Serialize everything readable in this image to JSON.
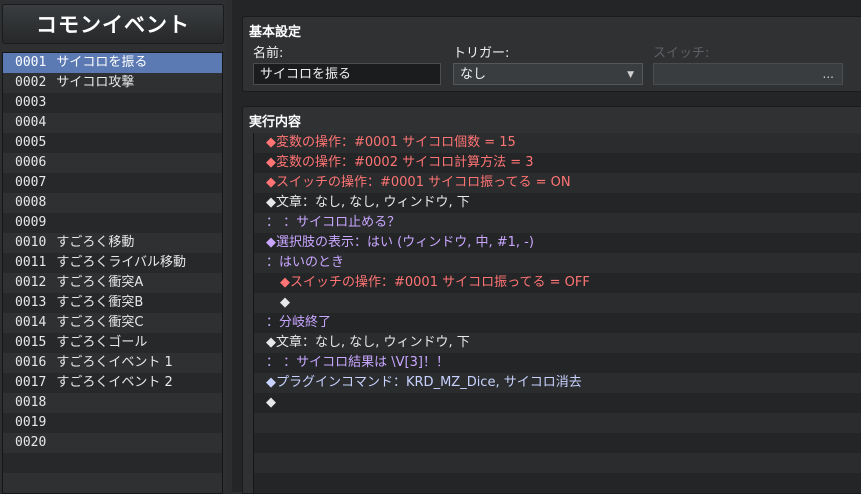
{
  "left_panel": {
    "title": "コモンイベント",
    "events": [
      {
        "id": "0001",
        "name": "サイコロを振る"
      },
      {
        "id": "0002",
        "name": "サイコロ攻撃"
      },
      {
        "id": "0003",
        "name": ""
      },
      {
        "id": "0004",
        "name": ""
      },
      {
        "id": "0005",
        "name": ""
      },
      {
        "id": "0006",
        "name": ""
      },
      {
        "id": "0007",
        "name": ""
      },
      {
        "id": "0008",
        "name": ""
      },
      {
        "id": "0009",
        "name": ""
      },
      {
        "id": "0010",
        "name": "すごろく移動"
      },
      {
        "id": "0011",
        "name": "すごろくライバル移動"
      },
      {
        "id": "0012",
        "name": "すごろく衝突A"
      },
      {
        "id": "0013",
        "name": "すごろく衝突B"
      },
      {
        "id": "0014",
        "name": "すごろく衝突C"
      },
      {
        "id": "0015",
        "name": "すごろくゴール"
      },
      {
        "id": "0016",
        "name": "すごろくイベント 1"
      },
      {
        "id": "0017",
        "name": "すごろくイベント 2"
      },
      {
        "id": "0018",
        "name": ""
      },
      {
        "id": "0019",
        "name": ""
      },
      {
        "id": "0020",
        "name": ""
      }
    ],
    "selected_index": 0
  },
  "basic_settings": {
    "title": "基本設定",
    "name_label": "名前:",
    "name_value": "サイコロを振る",
    "trigger_label": "トリガー:",
    "trigger_value": "なし",
    "switch_label": "スイッチ:",
    "switch_value": "",
    "switch_button": "..."
  },
  "execution": {
    "title": "実行内容",
    "commands": [
      {
        "text": "◆変数の操作：#0001 サイコロ個数 = 15",
        "color": "red",
        "indent": 1
      },
      {
        "text": "◆変数の操作：#0002 サイコロ計算方法 = 3",
        "color": "red",
        "indent": 1
      },
      {
        "text": "◆スイッチの操作：#0001 サイコロ振ってる = ON",
        "color": "red",
        "indent": 1
      },
      {
        "text": "◆文章：なし, なし, ウィンドウ, 下",
        "color": "white",
        "indent": 1
      },
      {
        "text": "：     ：サイコロ止める？",
        "color": "violet",
        "indent": 1
      },
      {
        "text": "◆選択肢の表示：はい (ウィンドウ, 中, #1, -)",
        "color": "violet",
        "indent": 1
      },
      {
        "text": "：はいのとき",
        "color": "violet",
        "indent": 1
      },
      {
        "text": "◆スイッチの操作：#0001 サイコロ振ってる = OFF",
        "color": "red",
        "indent": 2
      },
      {
        "text": "◆",
        "color": "white",
        "indent": 2
      },
      {
        "text": "：分岐終了",
        "color": "violet",
        "indent": 1
      },
      {
        "text": "◆文章：なし, なし, ウィンドウ, 下",
        "color": "white",
        "indent": 1
      },
      {
        "text": "：     ：サイコロ結果は \\V[3]！！",
        "color": "violet",
        "indent": 1
      },
      {
        "text": "◆プラグインコマンド：KRD_MZ_Dice, サイコロ消去",
        "color": "blue",
        "indent": 1
      },
      {
        "text": "◆",
        "color": "white",
        "indent": 1
      }
    ]
  }
}
